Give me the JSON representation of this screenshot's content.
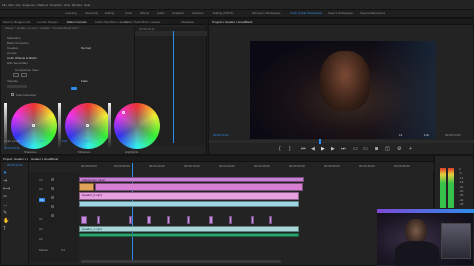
{
  "menu": {
    "items": [
      "File",
      "Edit",
      "Clip",
      "Sequence",
      "Markers",
      "Graphics",
      "View",
      "Window",
      "Help"
    ]
  },
  "workspaces": {
    "tabs": [
      "Learning",
      "Assembly",
      "Editing",
      "Color",
      "Effects",
      "Audio",
      "Graphics",
      "Libraries",
      "Editing (CS5.5)",
      "Mooney's Workspace",
      "Color Grade Workspace",
      "Sean's Workspace",
      "Supercollaborators"
    ],
    "active_index": 10
  },
  "effect_panel": {
    "tabs": [
      "Source: Budget.mp4",
      "Lumetri Scopes",
      "Effect Controls",
      "Audio Clip Mixer: Header",
      "Audio Track Mixer: Header",
      "Metadata"
    ],
    "active_index": 2,
    "header_path": "Master * Header_0.mp4  >  Header * Hooded Band (01) * ...",
    "rows": [
      {
        "label": "Saturation",
        "value": ""
      },
      {
        "label": "Basic Correction",
        "value": ""
      },
      {
        "label": "Creative",
        "value": "Normal"
      },
      {
        "label": "Curves",
        "value": ""
      },
      {
        "label": "Color Wheels & Match",
        "value": ""
      },
      {
        "label": "HSL Secondary",
        "value": ""
      },
      {
        "label": "Vignette",
        "value": "Fade"
      }
    ],
    "match_label": "Comparison View",
    "match_button": "Apply Match",
    "face_detection_label": "Face Detection",
    "wheels": [
      {
        "label": "Shadows"
      },
      {
        "label": "Midtones"
      },
      {
        "label": "Highlights"
      }
    ],
    "footer_label": "Color Levels",
    "footer_values": [
      "47.1",
      "100",
      "100"
    ],
    "timecode": "00:00:13:11"
  },
  "program_monitor": {
    "title": "Program: Header x HoodBand",
    "timecode_left": "00:00:13:11",
    "fit": "Fit",
    "quality": "Full",
    "timecode_right": "00:00:13:21"
  },
  "project_panel": {
    "tabs": [
      "Project: Header x HoodBand",
      "Media Browser",
      "Libraries",
      "Info"
    ],
    "sequence_timecode": "00:00:13:11",
    "item_label": "Header_0 mp4"
  },
  "timeline": {
    "tabs": [
      "Header x HoodBand"
    ],
    "timecode": "00:00:13:11",
    "ruler_labels": [
      "00:00:00:00",
      "00:00:05:00",
      "00:00:10:00",
      "00:00:15:00",
      "00:00:20:00",
      "00:00:25:00",
      "00:00:30:00",
      "00:00:35:00",
      "00:00:40:00",
      "00:00:45:00",
      "00:00:50:00"
    ],
    "tracks": [
      {
        "name": "V3"
      },
      {
        "name": "V2"
      },
      {
        "name": "V1"
      },
      {
        "name": "A1"
      },
      {
        "name": "A2"
      },
      {
        "name": "A3"
      },
      {
        "name": "Master",
        "value": "0.0"
      }
    ],
    "clip_labels": [
      "Adjustment Layer",
      "Header_0.mp4",
      "Header_1.mp4"
    ]
  },
  "audio_meter": {
    "scale": [
      "0",
      "-6",
      "-12",
      "-18",
      "-24",
      "-30",
      "-36",
      "-42",
      "-48",
      "-54",
      "dB"
    ]
  },
  "colors": {
    "accent": "#2d8ceb",
    "clip_pink": "#e48fd3",
    "clip_violet": "#c88ae0",
    "clip_green": "#2aa36a",
    "meter_green": "#36c24a",
    "meter_yellow": "#e2d23a",
    "meter_red": "#e23a2a"
  }
}
